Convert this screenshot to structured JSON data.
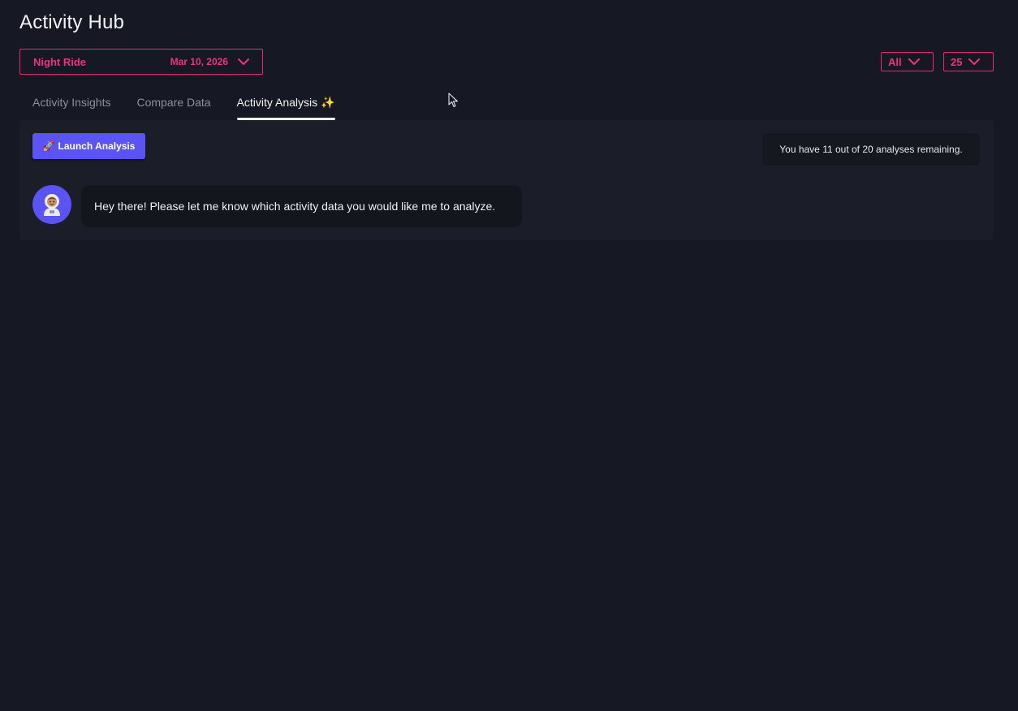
{
  "page": {
    "title": "Activity Hub"
  },
  "activity_selector": {
    "name": "Night Ride",
    "date": "Mar 10, 2026",
    "icon": "chevron-down-icon"
  },
  "filters": {
    "type": {
      "value": "All",
      "icon": "chevron-down-icon"
    },
    "count": {
      "value": "25",
      "icon": "chevron-down-icon"
    }
  },
  "tabs": [
    {
      "label": "Activity Insights",
      "active": false
    },
    {
      "label": "Compare Data",
      "active": false
    },
    {
      "label": "Activity Analysis",
      "suffix": "✨",
      "active": true
    }
  ],
  "analysis": {
    "launch_button": {
      "label": "Launch Analysis",
      "icon": "🚀"
    },
    "quota_text": "You have 11 out of 20 analyses remaining.",
    "message": {
      "avatar_icon": "astronaut-icon",
      "text": "Hey there! Please let me know which activity data you would like me to analyze."
    }
  },
  "colors": {
    "background": "#161923",
    "panel": "#1b1e28",
    "accent_pink": "#e9357f",
    "accent_purple": "#5a54f4"
  }
}
